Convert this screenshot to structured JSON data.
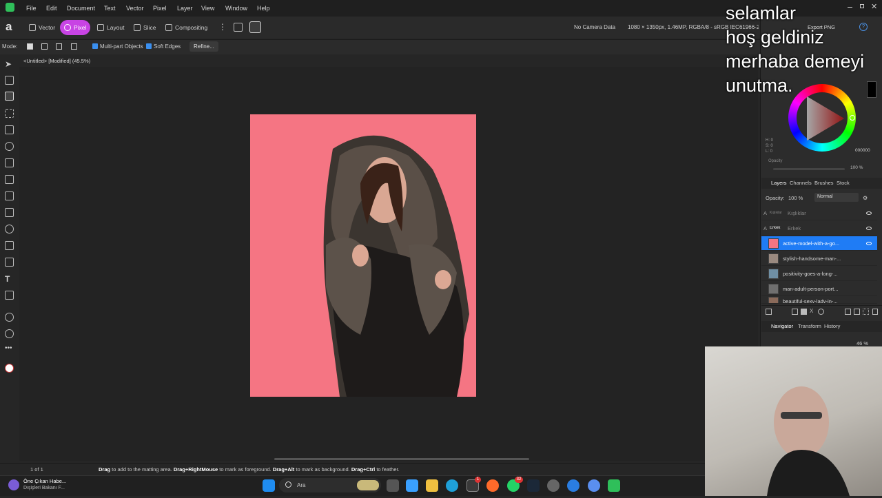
{
  "menubar": {
    "items": [
      "File",
      "Edit",
      "Document",
      "Text",
      "Vector",
      "Pixel",
      "Layer",
      "View",
      "Window",
      "Help"
    ]
  },
  "toolbar": {
    "personas": [
      "Vector",
      "Pixel",
      "Layout",
      "Slice",
      "Compositing"
    ],
    "active_persona": "Pixel",
    "camera": "No Camera Data",
    "doc_info": "1080 × 1350px, 1.46MP, RGBA/8 - sRGB IEC61966-2.1",
    "export": "Export PNG"
  },
  "contextbar": {
    "mode_label": "Mode:",
    "multipart": "Multi-part Objects",
    "soft_edges": "Soft Edges",
    "refine": "Refine..."
  },
  "document": {
    "tab_title": "<Untitled> [Modified] (45.5%)"
  },
  "color_panel": {
    "hex": "000000",
    "h": "H: 0",
    "s": "S: 0",
    "l": "L: 0",
    "opacity_label": "Opacity",
    "opacity_value": "100 %"
  },
  "layers_panel": {
    "tabs": [
      "Layers",
      "Channels",
      "Brushes",
      "Stock"
    ],
    "opacity_label": "Opacity:",
    "opacity_value": "100 %",
    "blend_mode": "Normal",
    "layers": [
      {
        "name": "Kışlıklar",
        "kind": "text",
        "thumb_text": "Kışlıklar"
      },
      {
        "name": "Erkek",
        "kind": "text",
        "thumb_text": "Erkek"
      },
      {
        "name": "active-model-with-a-go...",
        "kind": "image",
        "selected": true
      },
      {
        "name": "stylish-handsome-man-...",
        "kind": "image"
      },
      {
        "name": "positivity-goes-a-long-...",
        "kind": "image"
      },
      {
        "name": "man-adult-person-port...",
        "kind": "image"
      },
      {
        "name": "beautiful-sexy-lady-in-...",
        "kind": "image"
      }
    ]
  },
  "navigator_panel": {
    "tabs": [
      "Navigator",
      "Transform",
      "History"
    ],
    "zoom": "46 %"
  },
  "statusbar": {
    "page": "1 of 1",
    "hint_parts": [
      {
        "bold": "Drag",
        "text": " to add to the matting area. "
      },
      {
        "bold": "Drag+RightMouse",
        "text": " to mark as foreground. "
      },
      {
        "bold": "Drag+Alt",
        "text": " to mark as background. "
      },
      {
        "bold": "Drag+Ctrl",
        "text": " to feather."
      }
    ]
  },
  "taskbar": {
    "news_title": "Öne Çıkan Habe...",
    "news_sub": "Dışişleri Bakanı F...",
    "search": "Ara",
    "badge_1": "1",
    "badge_2": "32"
  },
  "overlay": {
    "lines": [
      "selamlar",
      "hoş geldiniz",
      "merhaba demeyi",
      "unutma."
    ]
  },
  "colors": {
    "accent": "#c844e4",
    "selection": "#1f7cf5",
    "artboard_bg": "#f57583"
  }
}
